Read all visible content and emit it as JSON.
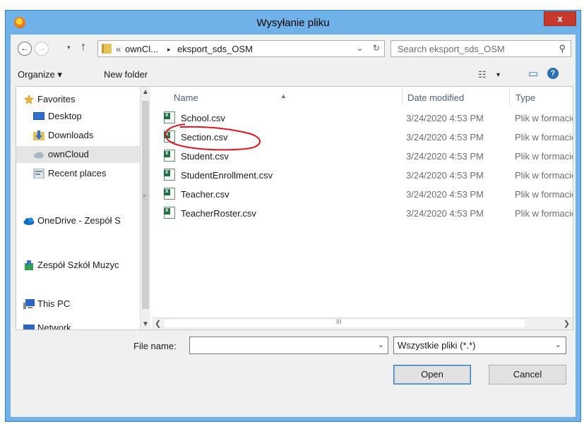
{
  "window": {
    "title": "Wysyłanie pliku",
    "close_label": "x",
    "accent_color": "#6fb2e9",
    "icon": "firefox-icon"
  },
  "navigation": {
    "back_icon": "←",
    "forward_icon": "→",
    "dropdown_icon": "▾",
    "up_icon": "↑",
    "breadcrumb_overflow": "«",
    "breadcrumb_parent": "ownCl...",
    "breadcrumb_sep": "▸",
    "breadcrumb_current": "eksport_sds_OSM",
    "addr_dropdown": "⌄",
    "refresh_icon": "↻",
    "search_placeholder": "Search eksport_sds_OSM",
    "search_icon_glyph": "⚲"
  },
  "toolbar": {
    "organize_label": "Organize ▾",
    "new_folder_label": "New folder",
    "view_icon_glyph": "☷",
    "view_dropdown": "▾",
    "preview_icon_glyph": "▭",
    "help_icon_glyph": "?"
  },
  "sidebar": {
    "items": [
      {
        "label": "Favorites",
        "icon": "star-icon"
      },
      {
        "label": "Desktop",
        "icon": "desktop-icon"
      },
      {
        "label": "Downloads",
        "icon": "downloads-icon"
      },
      {
        "label": "ownCloud",
        "icon": "cloud-icon",
        "selected": true
      },
      {
        "label": "Recent places",
        "icon": "recent-places-icon"
      },
      {
        "label": "OneDrive - Zespół S",
        "icon": "onedrive-icon"
      },
      {
        "label": "Zespół Szkół Muzyc",
        "icon": "sharepoint-icon"
      },
      {
        "label": "This PC",
        "icon": "computer-icon"
      },
      {
        "label": "Network",
        "icon": "network-icon"
      }
    ]
  },
  "file_list": {
    "columns": [
      "Name",
      "Date modified",
      "Type"
    ],
    "rows": [
      {
        "name": "School.csv",
        "date": "3/24/2020 4:53 PM",
        "type": "Plik w formacie CSV"
      },
      {
        "name": "Section.csv",
        "date": "3/24/2020 4:53 PM",
        "type": "Plik w formacie CSV"
      },
      {
        "name": "Student.csv",
        "date": "3/24/2020 4:53 PM",
        "type": "Plik w formacie CSV"
      },
      {
        "name": "StudentEnrollment.csv",
        "date": "3/24/2020 4:53 PM",
        "type": "Plik w formacie CSV"
      },
      {
        "name": "Teacher.csv",
        "date": "3/24/2020 4:53 PM",
        "type": "Plik w formacie CSV"
      },
      {
        "name": "TeacherRoster.csv",
        "date": "3/24/2020 4:53 PM",
        "type": "Plik w formacie CSV"
      }
    ],
    "scroll_grip": "III"
  },
  "footer": {
    "file_name_label": "File name:",
    "file_name_value": "",
    "file_type_value": "Wszystkie pliki (*.*)",
    "open_label": "Open",
    "cancel_label": "Cancel"
  },
  "annotation": {
    "color": "#e0141e",
    "target": "School.csv"
  }
}
